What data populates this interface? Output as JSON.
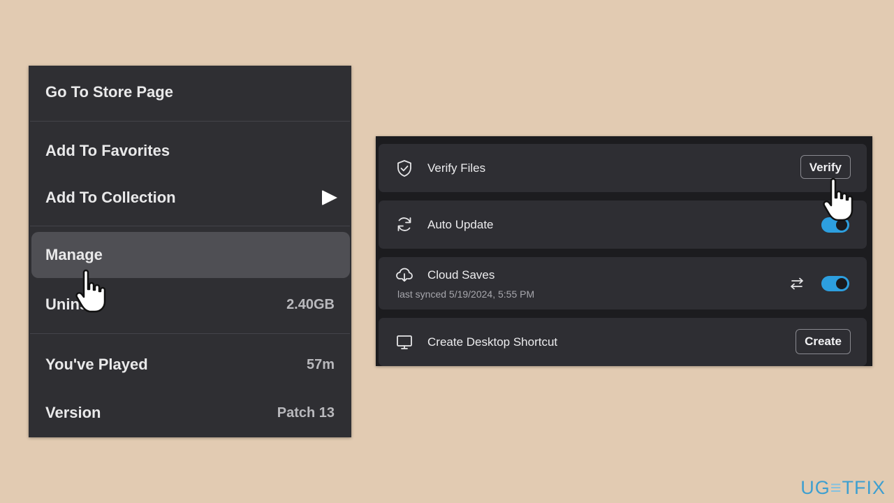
{
  "menu": {
    "items": [
      {
        "label": "Go To Store Page",
        "value": ""
      },
      {
        "label": "Add To Favorites",
        "value": ""
      },
      {
        "label": "Add To Collection",
        "value": "",
        "icon": "play-arrow-icon"
      },
      {
        "label": "Manage",
        "value": "",
        "highlighted": true
      },
      {
        "label": "Unins",
        "label_tail": "l",
        "value": "2.40GB"
      },
      {
        "label": "You've Played",
        "value": "57m"
      },
      {
        "label": "Version",
        "value": "Patch 13"
      }
    ]
  },
  "settings": {
    "verify": {
      "label": "Verify Files",
      "button": "Verify",
      "icon": "shield-check-icon"
    },
    "auto_update": {
      "label": "Auto Update",
      "enabled": true,
      "icon": "refresh-icon"
    },
    "cloud_saves": {
      "label": "Cloud Saves",
      "subtext": "last synced 5/19/2024, 5:55 PM",
      "enabled": true,
      "icon": "cloud-download-icon",
      "sync_icon": "swap-arrows-icon"
    },
    "shortcut": {
      "label": "Create Desktop Shortcut",
      "button": "Create",
      "icon": "monitor-icon"
    }
  },
  "colors": {
    "toggle_on": "#2d9fdf",
    "menu_bg": "#2f2f33",
    "highlight": "#4f4f54",
    "page_bg": "#e2cbb2"
  },
  "watermark": {
    "left": "UG",
    "mid": "≡",
    "right": "TFIX"
  }
}
